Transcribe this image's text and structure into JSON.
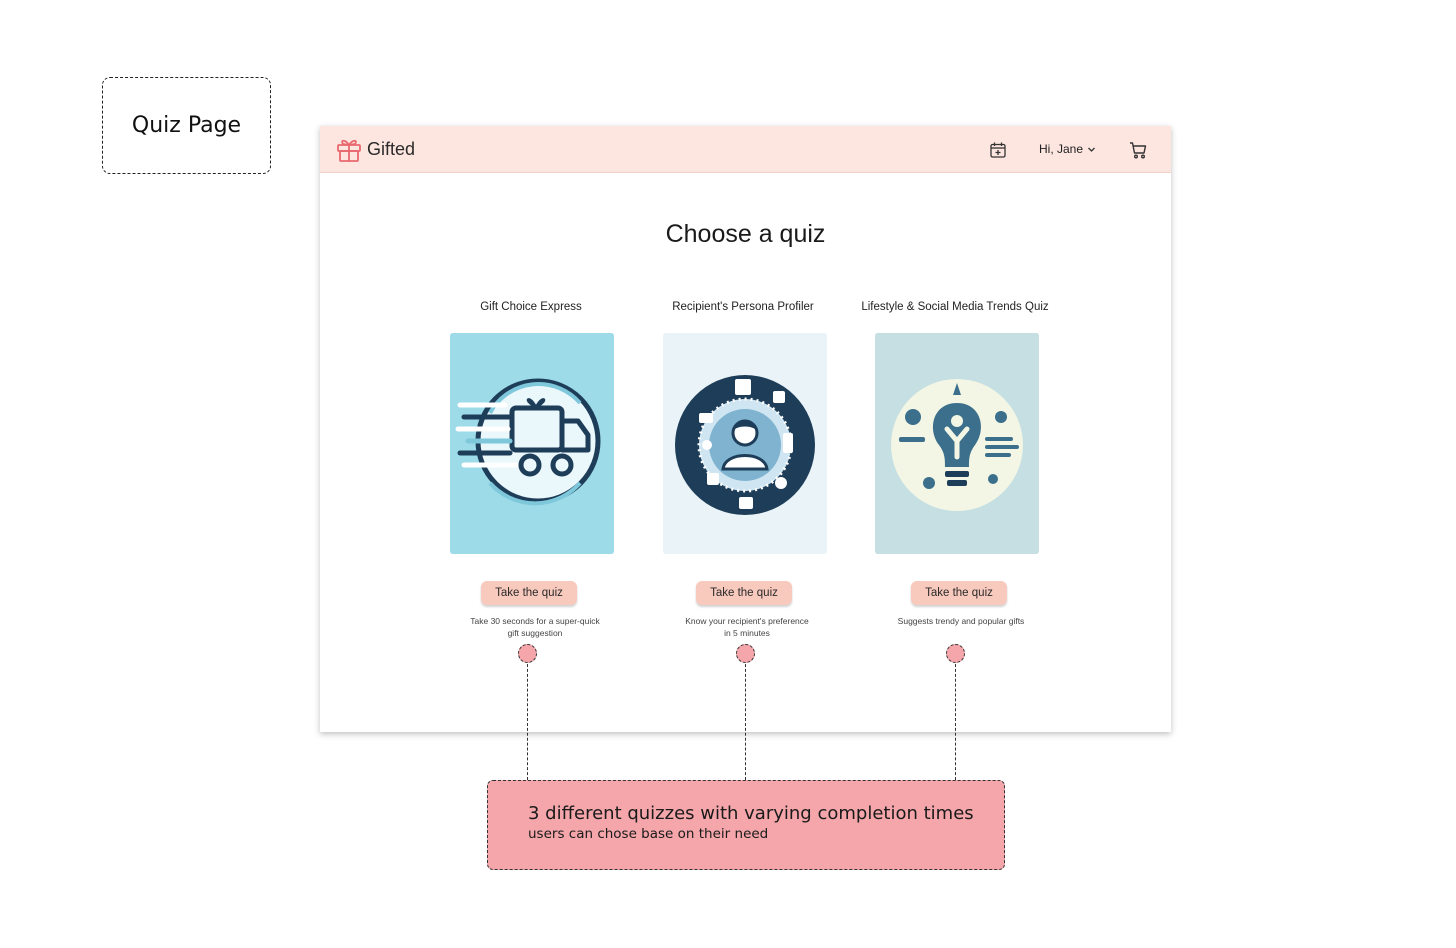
{
  "annotation": {
    "page_label": "Quiz Page",
    "note_title": "3 different quizzes with varying completion times",
    "note_subtitle": "users can chose base on their need"
  },
  "navbar": {
    "brand": "Gifted",
    "greeting": "Hi, Jane",
    "icons": [
      "gift-icon",
      "calendar-icon",
      "chevron-down-icon",
      "cart-icon"
    ]
  },
  "main": {
    "title": "Choose a quiz",
    "quizzes": [
      {
        "title": "Gift Choice Express",
        "button": "Take the quiz",
        "description": "Take 30 seconds for a super-quick gift suggestion",
        "image": "speeding-delivery-truck-illustration"
      },
      {
        "title": "Recipient's Persona Profiler",
        "button": "Take the quiz",
        "description": "Know your recipient's preference in 5 minutes",
        "image": "persona-profile-circle-illustration"
      },
      {
        "title": "Lifestyle & Social Media Trends Quiz",
        "button": "Take the quiz",
        "description": "Suggests trendy and popular gifts",
        "image": "lightbulb-trends-illustration"
      }
    ]
  },
  "colors": {
    "navbar_bg": "#fde5e0",
    "button_bg": "#f8c9bd",
    "brand_accent": "#e8686e",
    "annotation_bg": "#f4a6aa"
  }
}
